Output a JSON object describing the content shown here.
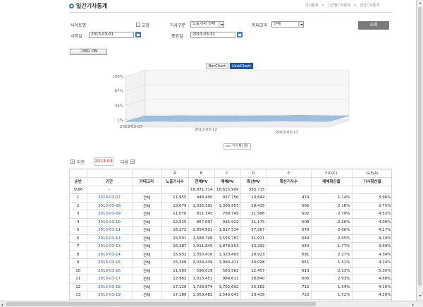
{
  "page": {
    "title": "일간기사통계",
    "breadcrumb": [
      "기사통계",
      ">",
      "기간별기사통계",
      ">",
      "일간기사통계"
    ]
  },
  "filters": {
    "site_label": "사이트명",
    "fixed_label": "고정",
    "article_type_label": "기사구분",
    "article_type_value": "노출기사 전체",
    "category_label": "카테고리",
    "category_value": "전체",
    "start_label": "시작일",
    "start_value": "2013-03-01",
    "end_label": "종료일",
    "end_value": "2013-03-31",
    "search_button": "조회",
    "graph_button": "그래프 ON"
  },
  "chart": {
    "tabs": [
      {
        "label": "BarChart",
        "active": false
      },
      {
        "label": "LineChart",
        "active": true
      }
    ],
    "legend_label": "기사확산율",
    "series_color": "#9dbfe0"
  },
  "chart_data": {
    "type": "line",
    "y_ticks": [
      "100%",
      "67%",
      "34%",
      "1%"
    ],
    "x_labels": [
      "2013-03-07",
      "2013-03-12",
      "2013-03-17"
    ],
    "ylim": [
      1,
      100
    ],
    "series": [
      {
        "name": "기사확산율",
        "x": [
          "2013-03-07",
          "2013-03-08",
          "2013-03-09",
          "2013-03-10",
          "2013-03-11",
          "2013-03-12",
          "2013-03-13",
          "2013-03-14",
          "2013-03-15",
          "2013-03-16",
          "2013-03-17",
          "2013-03-18",
          "2013-03-19"
        ],
        "values": [
          3.96,
          3.75,
          4.53,
          4.06,
          4.17,
          4.19,
          3.99,
          4.34,
          4.25,
          5.3,
          4.68,
          4.16,
          4.2
        ]
      }
    ],
    "grid": true,
    "legend_position": "bottom"
  },
  "monthnav": {
    "prev_label": "이전",
    "current": "2013-03",
    "next_label": "다음"
  },
  "table": {
    "letters": [
      "",
      "",
      "",
      "A",
      "B",
      "C",
      "D",
      "E",
      "F(D/C)",
      "G(E/A)"
    ],
    "headers": [
      "순번",
      "기간",
      "카테고리",
      "노출기사수",
      "전체PV",
      "매체PV",
      "확산PV",
      "확산기사수",
      "매체확산율",
      "기사확산율"
    ],
    "sum": {
      "no": "SUM",
      "date": "-",
      "cat": "",
      "a": "",
      "b": "18,971,714",
      "c": "18,615,999",
      "d": "355,715",
      "e": "",
      "f": "",
      "g": ""
    },
    "rows": [
      {
        "no": "1",
        "date": "2013-03-07",
        "cat": "전체",
        "a": "11,955",
        "b": "948,400",
        "c": "937,756",
        "d": "10,644",
        "e": "474",
        "f": "1.14%",
        "g": "3.96%"
      },
      {
        "no": "2",
        "date": "2013-03-08",
        "cat": "전체",
        "a": "15,079",
        "b": "1,335,392",
        "c": "1,306,957",
        "d": "28,435",
        "e": "566",
        "f": "2.18%",
        "g": "3.75%"
      },
      {
        "no": "3",
        "date": "2013-03-09",
        "cat": "전체",
        "a": "11,078",
        "b": "811,745",
        "c": "789,749",
        "d": "21,996",
        "e": "502",
        "f": "2.79%",
        "g": "4.53%"
      },
      {
        "no": "4",
        "date": "2013-03-10",
        "cat": "전체",
        "a": "12,525",
        "b": "957,097",
        "c": "935,922",
        "d": "21,175",
        "e": "508",
        "f": "2.26%",
        "g": "4.06%"
      },
      {
        "no": "5",
        "date": "2013-03-11",
        "cat": "전체",
        "a": "16,272",
        "b": "1,854,901",
        "c": "1,817,534",
        "d": "37,367",
        "e": "678",
        "f": "2.06%",
        "g": "4.17%"
      },
      {
        "no": "6",
        "date": "2013-03-12",
        "cat": "전체",
        "a": "15,501",
        "b": "1,588,708",
        "c": "1,556,787",
        "d": "31,921",
        "e": "649",
        "f": "2.05%",
        "g": "4.19%"
      },
      {
        "no": "7",
        "date": "2013-03-13",
        "cat": "전체",
        "a": "16,287",
        "b": "1,911,845",
        "c": "1,878,553",
        "d": "33,292",
        "e": "650",
        "f": "1.77%",
        "g": "3.99%"
      },
      {
        "no": "8",
        "date": "2013-03-14",
        "cat": "전체",
        "a": "15,932",
        "b": "1,350,416",
        "c": "1,320,493",
        "d": "29,923",
        "e": "691",
        "f": "2.27%",
        "g": "4.34%"
      },
      {
        "no": "9",
        "date": "2013-03-15",
        "cat": "전체",
        "a": "15,348",
        "b": "2,024,439",
        "c": "1,994,411",
        "d": "30,028",
        "e": "651",
        "f": "1.51%",
        "g": "4.24%"
      },
      {
        "no": "10",
        "date": "2013-03-16",
        "cat": "전체",
        "a": "11,565",
        "b": "596,019",
        "c": "583,562",
        "d": "12,457",
        "e": "613",
        "f": "2.13%",
        "g": "5.30%"
      },
      {
        "no": "11",
        "date": "2013-03-17",
        "cat": "전체",
        "a": "12,962",
        "b": "1,013,451",
        "c": "984,611",
        "d": "28,840",
        "e": "606",
        "f": "2.93%",
        "g": "4.68%"
      },
      {
        "no": "12",
        "date": "2013-03-18",
        "cat": "전체",
        "a": "17,120",
        "b": "1,728,874",
        "c": "1,702,692",
        "d": "26,182",
        "e": "712",
        "f": "1.54%",
        "g": "4.16%"
      },
      {
        "no": "13",
        "date": "2013-03-19",
        "cat": "전체",
        "a": "17,188",
        "b": "1,563,482",
        "c": "1,540,043",
        "d": "23,439",
        "e": "722",
        "f": "1.52%",
        "g": "4.20%"
      }
    ]
  }
}
